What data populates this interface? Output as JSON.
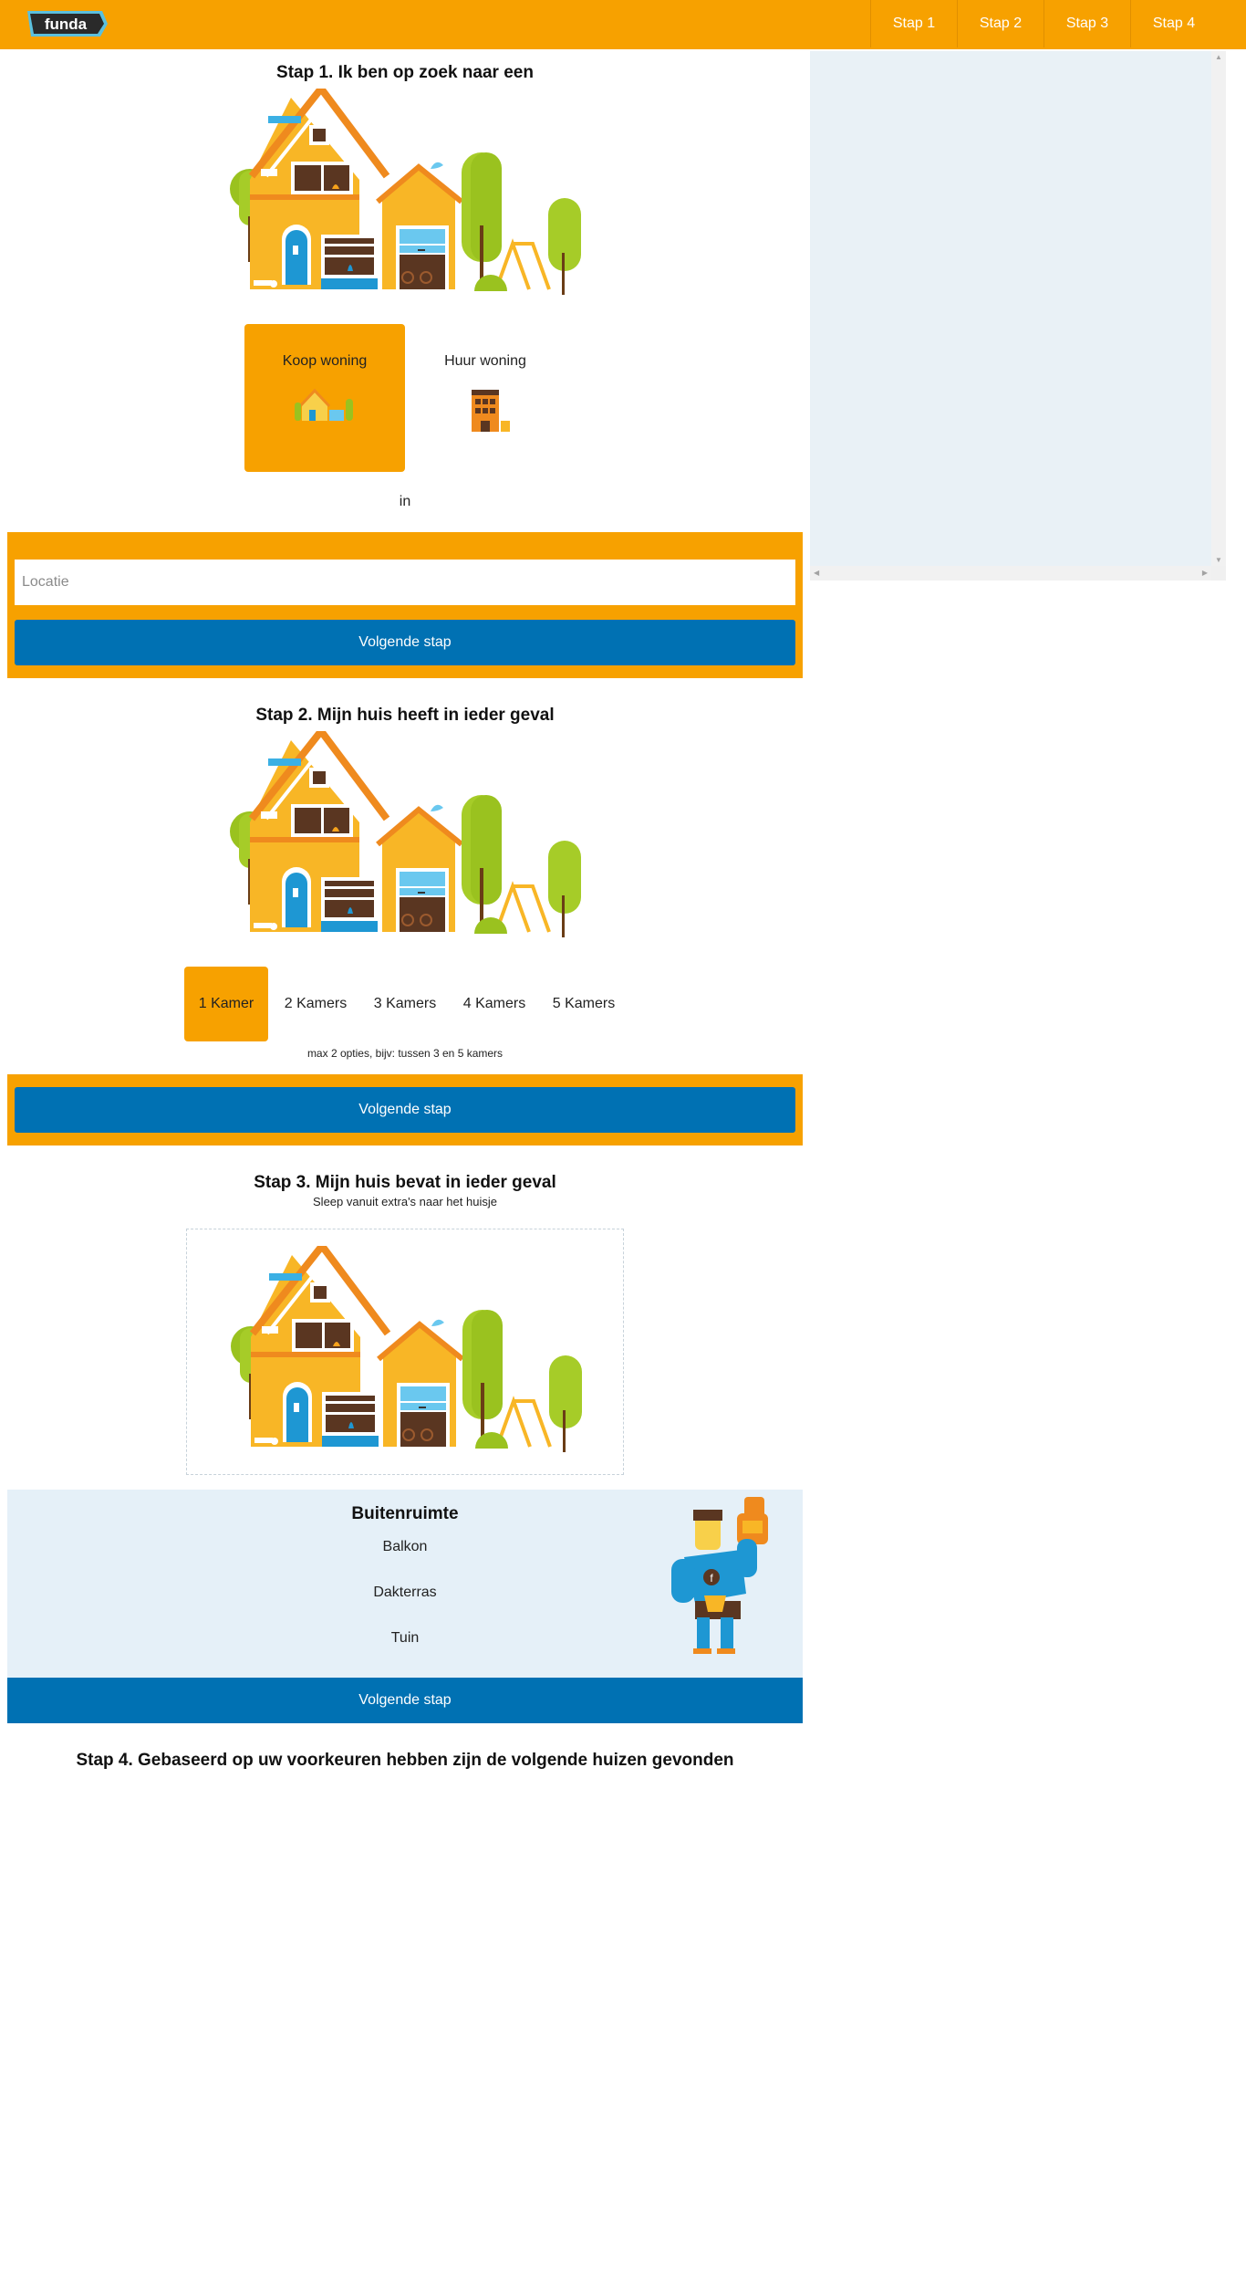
{
  "header": {
    "logo_text": "funda",
    "nav": [
      "Stap 1",
      "Stap 2",
      "Stap 3",
      "Stap 4"
    ]
  },
  "step1": {
    "title": "Stap 1. Ik ben op zoek naar een",
    "options": [
      {
        "label": "Koop woning",
        "selected": true
      },
      {
        "label": "Huur woning",
        "selected": false
      }
    ],
    "in_label": "in",
    "location_placeholder": "Locatie",
    "next_label": "Volgende stap"
  },
  "step2": {
    "title": "Stap 2. Mijn huis heeft in ieder geval",
    "rooms": [
      "1 Kamer",
      "2 Kamers",
      "3 Kamers",
      "4 Kamers",
      "5 Kamers"
    ],
    "selected_room": "1 Kamer",
    "hint": "max 2 opties, bijv: tussen 3 en 5 kamers",
    "next_label": "Volgende stap"
  },
  "step3": {
    "title": "Stap 3. Mijn huis bevat in ieder geval",
    "subtitle": "Sleep vanuit extra's naar het huisje",
    "extras_title": "Buitenruimte",
    "extras": [
      "Balkon",
      "Dakterras",
      "Tuin"
    ],
    "next_label": "Volgende stap"
  },
  "step4": {
    "title": "Stap 4. Gebaseerd op uw voorkeuren hebben zijn de volgende huizen gevonden"
  },
  "colors": {
    "brand_orange": "#f7a100",
    "button_blue": "#0071b3",
    "extras_bg": "#e5f0f8"
  }
}
